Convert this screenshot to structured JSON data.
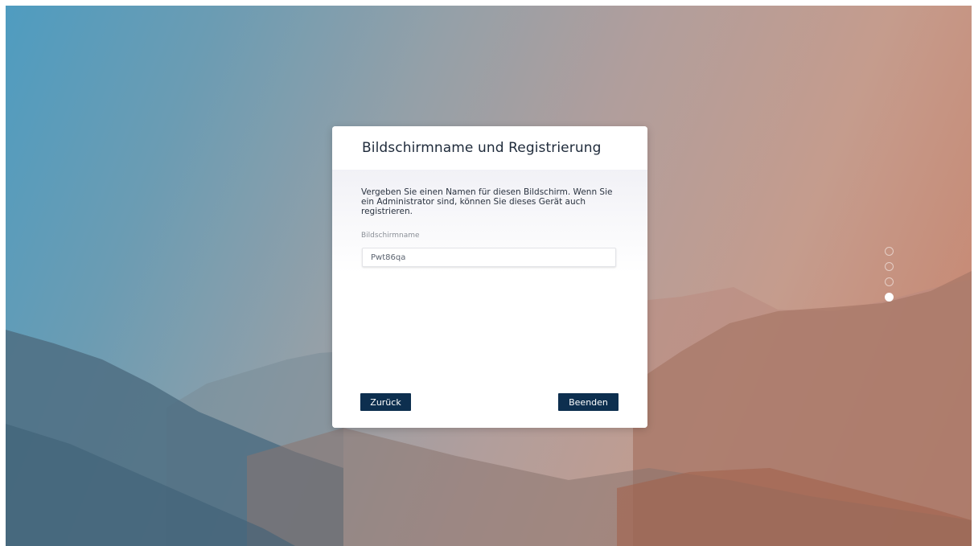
{
  "dialog": {
    "title": "Bildschirmname und Registrierung",
    "description": "Vergeben Sie einen Namen für diesen Bildschirm. Wenn Sie ein Administrator sind, können Sie dieses Gerät auch registrieren.",
    "field_label": "Bildschirmname",
    "field_value": "Pwt86qa",
    "back_label": "Zurück",
    "finish_label": "Beenden"
  },
  "steps": {
    "total": 4,
    "current": 4
  },
  "colors": {
    "button": "#0d2f4f",
    "title_text": "#1e2a3a"
  }
}
